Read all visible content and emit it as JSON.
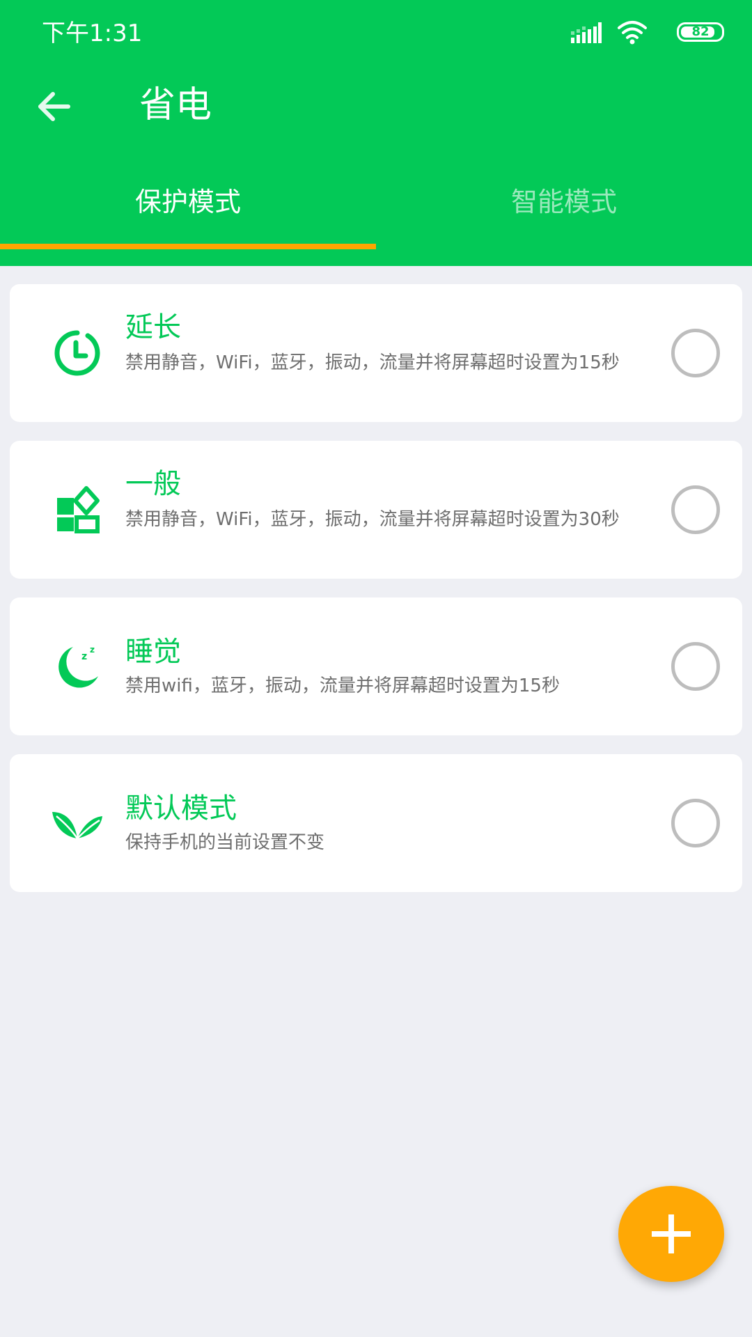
{
  "status_bar": {
    "time": "下午1:31",
    "battery_level": "82",
    "icons": [
      "signal-icon",
      "wifi-icon",
      "battery-icon"
    ]
  },
  "app_bar": {
    "back_icon": "arrow-left-icon",
    "title": "省电"
  },
  "tabs": [
    {
      "label": "保护模式",
      "selected": true
    },
    {
      "label": "智能模式",
      "selected": false
    }
  ],
  "modes": [
    {
      "title": "延长",
      "description": "禁用静音，WiFi，蓝牙，振动，流量并将屏幕超时设置为15秒",
      "icon": "clock-icon",
      "selected": false
    },
    {
      "title": "一般",
      "description": "禁用静音，WiFi，蓝牙，振动，流量并将屏幕超时设置为30秒",
      "icon": "shapes-icon",
      "selected": false
    },
    {
      "title": "睡觉",
      "description": "禁用wifi，蓝牙，振动，流量并将屏幕超时设置为15秒",
      "icon": "moon-sleep-icon",
      "selected": false
    },
    {
      "title": "默认模式",
      "description": "保持手机的当前设置不变",
      "icon": "leaf-icon",
      "selected": false
    }
  ],
  "fab": {
    "icon": "plus-icon"
  },
  "colors": {
    "primary_green": "#03c957",
    "accent_orange": "#ffa500",
    "background": "#eeeff4"
  }
}
